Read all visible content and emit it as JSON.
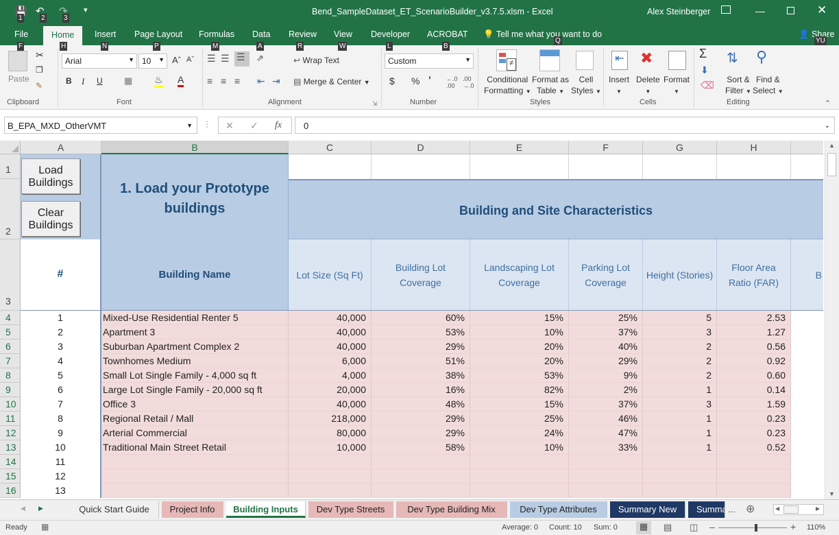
{
  "window": {
    "title": "Bend_SampleDataset_ET_ScenarioBuilder_v3.7.5.xlsm  -  Excel",
    "user": "Alex Steinberger"
  },
  "qat_keytips": [
    "1",
    "2",
    "3"
  ],
  "ribbon_tabs": [
    {
      "label": "File",
      "key": "F"
    },
    {
      "label": "Home",
      "key": "H"
    },
    {
      "label": "Insert",
      "key": "N"
    },
    {
      "label": "Page Layout",
      "key": "P"
    },
    {
      "label": "Formulas",
      "key": "M"
    },
    {
      "label": "Data",
      "key": "A"
    },
    {
      "label": "Review",
      "key": "R"
    },
    {
      "label": "View",
      "key": "W"
    },
    {
      "label": "Developer",
      "key": "L"
    },
    {
      "label": "ACROBAT",
      "key": "B"
    }
  ],
  "tell_me": {
    "label": "Tell me what you want to do",
    "key": "Q"
  },
  "share": {
    "label": "Share",
    "key": "YU"
  },
  "ribbon": {
    "clipboard": {
      "paste": "Paste",
      "group": "Clipboard"
    },
    "font": {
      "name": "Arial",
      "size": "10",
      "bold": "B",
      "italic": "I",
      "underline": "U",
      "group": "Font"
    },
    "alignment": {
      "wrap": "Wrap Text",
      "merge": "Merge & Center",
      "group": "Alignment"
    },
    "number": {
      "format": "Custom",
      "currency": "$",
      "percent": "%",
      "comma": "’",
      "group": "Number"
    },
    "styles": {
      "cond1": "Conditional",
      "cond2": "Formatting",
      "fmt1": "Format as",
      "fmt2": "Table",
      "cell1": "Cell",
      "cell2": "Styles",
      "group": "Styles"
    },
    "cells": {
      "insert": "Insert",
      "delete": "Delete",
      "format": "Format",
      "group": "Cells"
    },
    "editing": {
      "sort1": "Sort &",
      "sort2": "Filter",
      "find1": "Find &",
      "find2": "Select",
      "group": "Editing"
    }
  },
  "formula_bar": {
    "name_box": "B_EPA_MXD_OtherVMT",
    "fx": "fx",
    "value": "0"
  },
  "columns": [
    "A",
    "B",
    "C",
    "D",
    "E",
    "F",
    "G",
    "H"
  ],
  "rows": [
    "1",
    "2",
    "3",
    "4",
    "5",
    "6",
    "7",
    "8",
    "9",
    "10",
    "11",
    "12",
    "13",
    "14",
    "15",
    "16"
  ],
  "buttons": {
    "load": [
      "Load",
      "Buildings"
    ],
    "clear": [
      "Clear",
      "Buildings"
    ]
  },
  "sheet_title": [
    "1. Load your Prototype",
    "buildings"
  ],
  "section_header": "Building and Site Characteristics",
  "headers": {
    "num": "#",
    "name": "Building Name",
    "lot": "Lot Size (Sq Ft)",
    "bldg": [
      "Building Lot",
      "Coverage"
    ],
    "land": [
      "Landscaping Lot",
      "Coverage"
    ],
    "park": [
      "Parking Lot",
      "Coverage"
    ],
    "height": "Height (Stories)",
    "far": [
      "Floor Area",
      "Ratio (FAR)"
    ],
    "i_partial": "B"
  },
  "table": [
    {
      "n": "1",
      "name": "Mixed-Use Residential Renter 5",
      "lot": "40,000",
      "bldg": "60%",
      "land": "15%",
      "park": "25%",
      "h": "5",
      "far": "2.53"
    },
    {
      "n": "2",
      "name": "Apartment 3",
      "lot": "40,000",
      "bldg": "53%",
      "land": "10%",
      "park": "37%",
      "h": "3",
      "far": "1.27"
    },
    {
      "n": "3",
      "name": "Suburban Apartment Complex 2",
      "lot": "40,000",
      "bldg": "29%",
      "land": "20%",
      "park": "40%",
      "h": "2",
      "far": "0.56"
    },
    {
      "n": "4",
      "name": "Townhomes Medium",
      "lot": "6,000",
      "bldg": "51%",
      "land": "20%",
      "park": "29%",
      "h": "2",
      "far": "0.92"
    },
    {
      "n": "5",
      "name": "Small Lot Single Family - 4,000 sq ft",
      "lot": "4,000",
      "bldg": "38%",
      "land": "53%",
      "park": "9%",
      "h": "2",
      "far": "0.60"
    },
    {
      "n": "6",
      "name": "Large Lot Single Family - 20,000 sq ft",
      "lot": "20,000",
      "bldg": "16%",
      "land": "82%",
      "park": "2%",
      "h": "1",
      "far": "0.14"
    },
    {
      "n": "7",
      "name": "Office 3",
      "lot": "40,000",
      "bldg": "48%",
      "land": "15%",
      "park": "37%",
      "h": "3",
      "far": "1.59"
    },
    {
      "n": "8",
      "name": "Regional Retail / Mall",
      "lot": "218,000",
      "bldg": "29%",
      "land": "25%",
      "park": "46%",
      "h": "1",
      "far": "0.23"
    },
    {
      "n": "9",
      "name": "Arterial Commercial",
      "lot": "80,000",
      "bldg": "29%",
      "land": "24%",
      "park": "47%",
      "h": "1",
      "far": "0.23"
    },
    {
      "n": "10",
      "name": "Traditional Main Street Retail",
      "lot": "10,000",
      "bldg": "58%",
      "land": "10%",
      "park": "33%",
      "h": "1",
      "far": "0.52"
    },
    {
      "n": "11",
      "name": "",
      "lot": "",
      "bldg": "",
      "land": "",
      "park": "",
      "h": "",
      "far": ""
    },
    {
      "n": "12",
      "name": "",
      "lot": "",
      "bldg": "",
      "land": "",
      "park": "",
      "h": "",
      "far": ""
    },
    {
      "n": "13",
      "name": "",
      "lot": "",
      "bldg": "",
      "land": "",
      "park": "",
      "h": "",
      "far": ""
    }
  ],
  "sheet_tabs": [
    {
      "label": "Quick Start Guide",
      "color": "#f0f0f0",
      "fg": "#333"
    },
    {
      "label": "Project Info",
      "color": "#e6b8b7",
      "fg": "#222"
    },
    {
      "label": "Building Inputs",
      "color": "#ffffff",
      "fg": "#217346"
    },
    {
      "label": "Dev Type Streets",
      "color": "#e6b8b7",
      "fg": "#222"
    },
    {
      "label": "Dev Type Building Mix",
      "color": "#e6b8b7",
      "fg": "#222"
    },
    {
      "label": "Dev Type Attributes",
      "color": "#b8cce4",
      "fg": "#222"
    },
    {
      "label": "Summary New",
      "color": "#1f3864",
      "fg": "#ffffff"
    },
    {
      "label": "Summa",
      "color": "#1f3864",
      "fg": "#ffffff"
    }
  ],
  "more_tabs": "...",
  "status": {
    "ready": "Ready",
    "average": "Average: 0",
    "count": "Count: 10",
    "sum": "Sum: 0",
    "zoom": "110%"
  }
}
